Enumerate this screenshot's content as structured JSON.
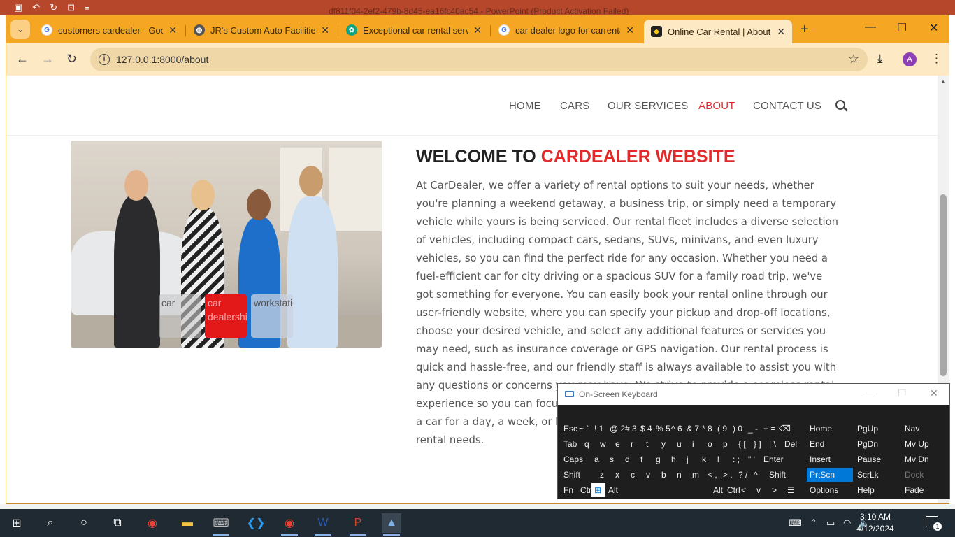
{
  "background_app": {
    "title": "df811f04-2ef2-479b-8d45-ea16fc40ac54 - PowerPoint (Product Activation Failed)"
  },
  "browser": {
    "tabs": [
      {
        "title": "customers cardealer - Goog",
        "favicon": "google-icon"
      },
      {
        "title": "JR's Custom Auto Facilities",
        "favicon": "globe-icon"
      },
      {
        "title": "Exceptional car rental servic",
        "favicon": "chatgpt-icon"
      },
      {
        "title": "car dealer logo for carrental",
        "favicon": "google-icon"
      },
      {
        "title": "Online Car Rental | About U",
        "favicon": "site-icon",
        "active": true
      }
    ],
    "url": "127.0.0.1:8000/about",
    "profile_initial": "A"
  },
  "site": {
    "nav": [
      {
        "label": "HOME"
      },
      {
        "label": "CARS"
      },
      {
        "label": "OUR SERVICES"
      },
      {
        "label": "ABOUT",
        "active": true
      },
      {
        "label": "CONTACT US"
      }
    ],
    "thumbnails": [
      {
        "alt": "car"
      },
      {
        "alt": "car dealership"
      },
      {
        "alt": "workstation"
      }
    ],
    "welcome_prefix": "WELCOME TO",
    "welcome_highlight": "CARDEALER WEBSITE",
    "about_text": "At CarDealer, we offer a variety of rental options to suit your needs, whether you're planning a weekend getaway, a business trip, or simply need a temporary vehicle while yours is being serviced. Our rental fleet includes a diverse selection of vehicles, including compact cars, sedans, SUVs, minivans, and even luxury vehicles, so you can find the perfect ride for any occasion. Whether you need a fuel-efficient car for city driving or a spacious SUV for a family road trip, we've got something for everyone. You can easily book your rental online through our user-friendly website, where you can specify your pickup and drop-off locations, choose your desired vehicle, and select any additional features or services you may need, such as insurance coverage or GPS navigation. Our rental process is quick and hassle-free, and our friendly staff is always available to assist you with any questions or concerns you may have. We strive to provide a seamless rental experience so you can focus on enjoying the journey ahead. So whether you need a car for a day, a week, or longer, CarDealer is your trusted partner for all your rental needs."
  },
  "osk": {
    "title": "On-Screen Keyboard",
    "rows": [
      [
        "Esc",
        "~ `",
        "! 1",
        "@ 2",
        "# 3",
        "$ 4",
        "% 5",
        "^ 6",
        "& 7",
        "* 8",
        "( 9",
        ") 0",
        "_ -",
        "+ =",
        "⌫",
        "Home",
        "PgUp",
        "Nav"
      ],
      [
        "Tab",
        "q",
        "w",
        "e",
        "r",
        "t",
        "y",
        "u",
        "i",
        "o",
        "p",
        "{ [",
        "} ]",
        "| \\",
        "Del",
        "End",
        "PgDn",
        "Mv Up"
      ],
      [
        "Caps",
        "a",
        "s",
        "d",
        "f",
        "g",
        "h",
        "j",
        "k",
        "l",
        ": ;",
        "\" '",
        "Enter",
        "Insert",
        "Pause",
        "Mv Dn"
      ],
      [
        "Shift",
        "z",
        "x",
        "c",
        "v",
        "b",
        "n",
        "m",
        "< ,",
        "> .",
        "? /",
        "^",
        "Shift",
        "PrtScn",
        "ScrLk",
        "Dock"
      ],
      [
        "Fn",
        "Ctrl",
        "⊞",
        "Alt",
        "Alt",
        "Ctrl",
        "<",
        "v",
        ">",
        "☰",
        "Options",
        "Help",
        "Fade"
      ]
    ]
  },
  "taskbar": {
    "time": "3:10 AM",
    "date": "4/12/2024",
    "notifications": "1"
  }
}
